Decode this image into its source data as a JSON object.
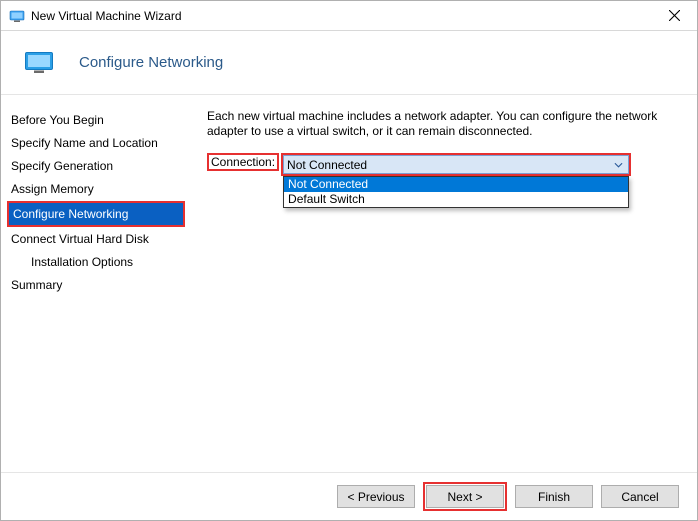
{
  "window": {
    "title": "New Virtual Machine Wizard"
  },
  "header": {
    "page_title": "Configure Networking"
  },
  "sidebar": {
    "steps": [
      "Before You Begin",
      "Specify Name and Location",
      "Specify Generation",
      "Assign Memory",
      "Configure Networking",
      "Connect Virtual Hard Disk",
      "Installation Options",
      "Summary"
    ],
    "selected_index": 4
  },
  "content": {
    "description": "Each new virtual machine includes a network adapter. You can configure the network adapter to use a virtual switch, or it can remain disconnected.",
    "connection_label": "Connection:",
    "connection_value": "Not Connected",
    "connection_options": [
      "Not Connected",
      "Default Switch"
    ]
  },
  "footer": {
    "previous": "< Previous",
    "next": "Next >",
    "finish": "Finish",
    "cancel": "Cancel"
  }
}
